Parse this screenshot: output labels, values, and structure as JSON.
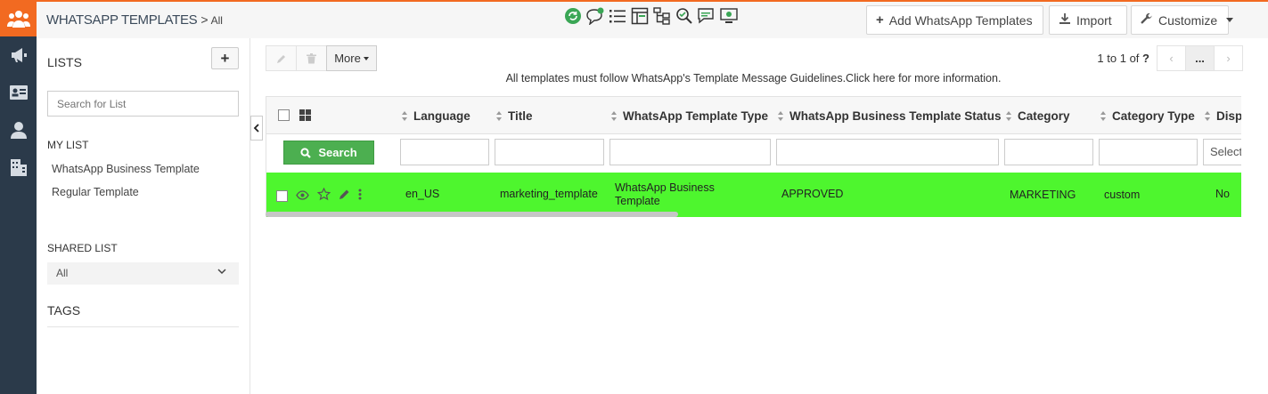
{
  "rail": {
    "icons": [
      "users-icon",
      "megaphone-icon",
      "id-card-icon",
      "person-icon",
      "building-icon"
    ]
  },
  "header": {
    "module": "WhatsApp Templates",
    "separator": ">",
    "view": "All",
    "quick_icons": [
      "refresh-icon",
      "chat-add-icon",
      "list-icon",
      "layout-icon",
      "hierarchy-icon",
      "search-check-icon",
      "chat-icon",
      "monitor-icon"
    ],
    "buttons": {
      "add": "Add WhatsApp Templates",
      "import": "Import",
      "customize": "Customize"
    }
  },
  "lists_panel": {
    "title": "LISTS",
    "search_placeholder": "Search for List",
    "my_list_title": "MY LIST",
    "my_list": [
      "WhatsApp Business Template",
      "Regular Template"
    ],
    "shared_list_title": "SHARED LIST",
    "shared_selected": "All",
    "tags_title": "TAGS"
  },
  "toolbar": {
    "more_label": "More",
    "pager_text": "1 to 1",
    "pager_of": "of",
    "pager_total": "?",
    "pager_dots": "..."
  },
  "notice": "All templates must follow WhatsApp's Template Message Guidelines.Click here for more information.",
  "table": {
    "columns": [
      "Language",
      "Title",
      "WhatsApp Template Type",
      "WhatsApp Business Template Status",
      "Category",
      "Category Type",
      "Disp"
    ],
    "search_label": "Search",
    "filter_select": "Select",
    "rows": [
      {
        "language": "en_US",
        "title": "marketing_template",
        "type": "WhatsApp Business Template",
        "status": "APPROVED",
        "category": "MARKETING",
        "category_type": "custom",
        "disp": "No"
      }
    ],
    "row_highlight_color": "#4ef62e"
  },
  "colors": {
    "brand": "#f26a21",
    "rail": "#2b3a4a",
    "search_button": "#4caf50"
  }
}
